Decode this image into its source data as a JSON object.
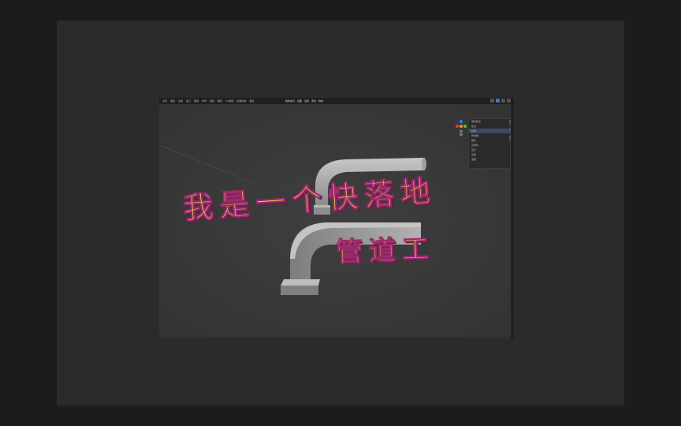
{
  "app": {
    "menu": [
      "文件",
      "编辑",
      "渲染",
      "窗口",
      "帮助",
      "布局",
      "建模",
      "雕刻",
      "UV编辑",
      "纹理绘制",
      "着色"
    ],
    "mode_label": "物体模式",
    "view_tools": [
      "视图",
      "选择",
      "添加",
      "物体"
    ]
  },
  "properties": {
    "rows": [
      "场景集合",
      "集合",
      "管道",
      "修改器",
      "细分",
      "实体化",
      "显示",
      "渲染",
      "变换"
    ]
  },
  "captions": {
    "line1": "我是一个快落地",
    "line2": "管道工"
  },
  "colors": {
    "caption_fill": "#f4e64a",
    "caption_outline": "#9b2a6b",
    "pipe": "#a9a9a9",
    "viewport_bg": "#3a3a3a",
    "accent": "#4a78c0"
  }
}
